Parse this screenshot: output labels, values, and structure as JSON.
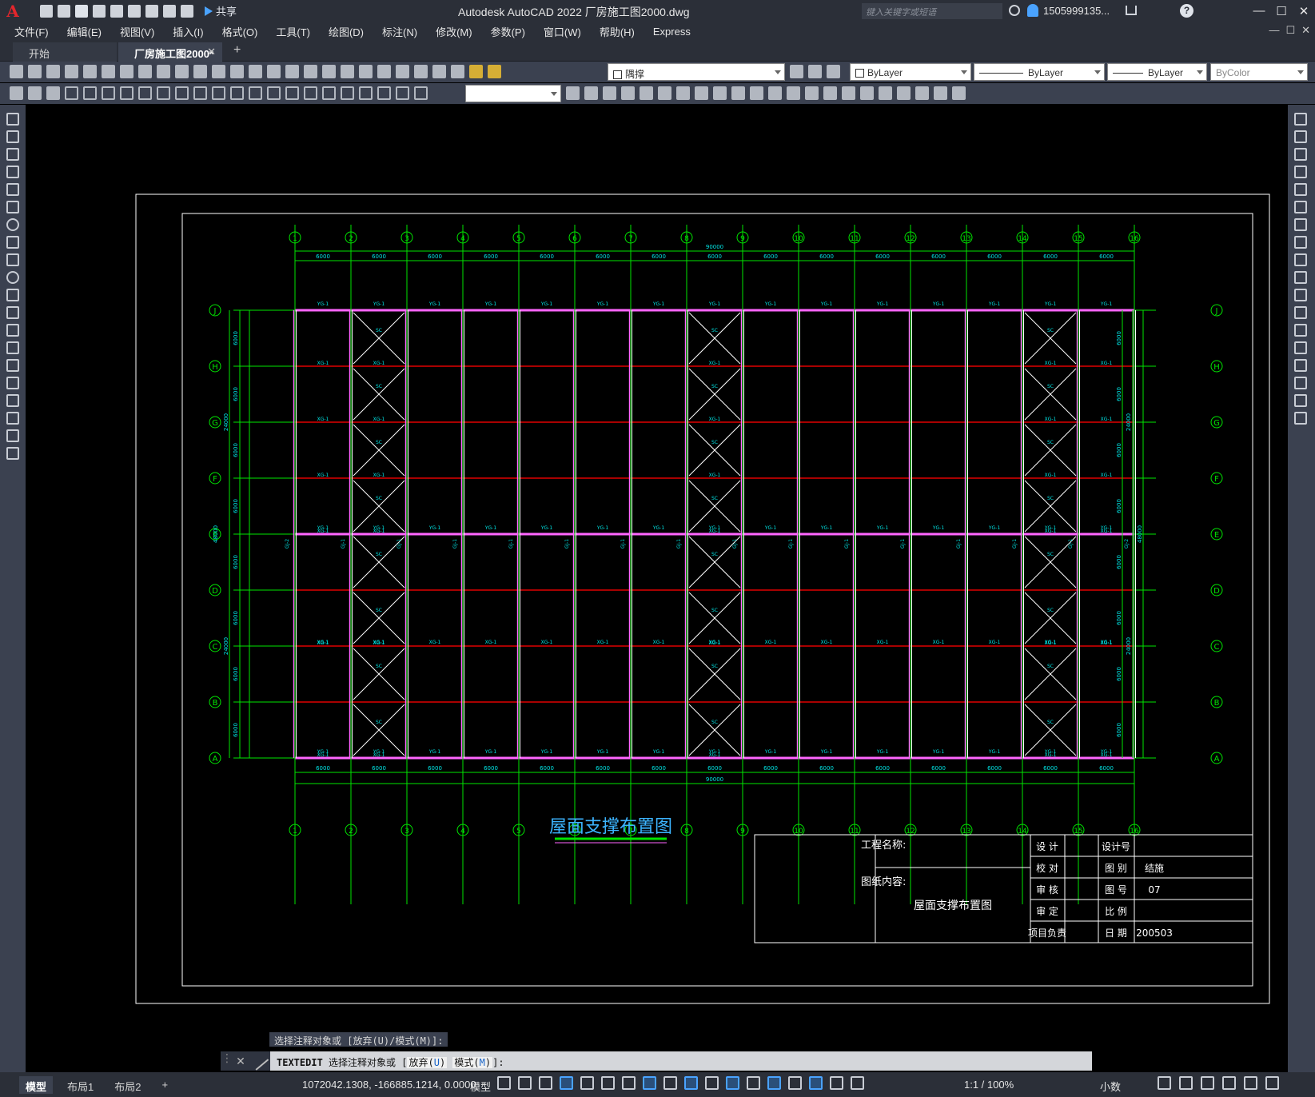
{
  "app": {
    "logo": "A",
    "title": "Autodesk AutoCAD 2022    厂房施工图2000.dwg",
    "share_label": "共享",
    "search_placeholder": "键入关键字或短语",
    "user": "1505999135...",
    "help": "?"
  },
  "window_controls": {
    "minimize": "—",
    "maximize": "☐",
    "close": "✕"
  },
  "menu": [
    "文件(F)",
    "编辑(E)",
    "视图(V)",
    "插入(I)",
    "格式(O)",
    "工具(T)",
    "绘图(D)",
    "标注(N)",
    "修改(M)",
    "参数(P)",
    "窗口(W)",
    "帮助(H)",
    "Express"
  ],
  "tabs": {
    "start": "开始",
    "active": "厂房施工图2000*",
    "close": "✕",
    "add": "+"
  },
  "properties": {
    "layer": "隅撑",
    "color": "ByLayer",
    "linetype": "ByLayer",
    "lineweight": "ByLayer",
    "plotstyle": "ByColor"
  },
  "drawing": {
    "column_axes": [
      "1",
      "2",
      "3",
      "4",
      "5",
      "6",
      "7",
      "8",
      "9",
      "10",
      "11",
      "12",
      "13",
      "14",
      "15",
      "16"
    ],
    "row_axes": [
      "J",
      "H",
      "G",
      "F",
      "E",
      "D",
      "C",
      "B",
      "A"
    ],
    "bay_dimension": "6000",
    "total_length": "90000",
    "row_dimension": "6000",
    "half_width": "24000",
    "total_width": "48000",
    "labels": {
      "purlin_edge": "YG-1",
      "tie": "XG-1",
      "brace": "SC",
      "gable_column": "GJ-1",
      "gable_column_end": "GJ-2"
    },
    "drawing_title": "屋面支撑布置图",
    "title_block": {
      "project_name_label": "工程名称:",
      "content_label": "图纸内容:",
      "content_value": "屋面支撑布置图",
      "design": "设  计",
      "check": "校  对",
      "review": "审  核",
      "approve": "审  定",
      "project_lead": "项目负责",
      "design_no_label": "设计号",
      "category_label": "图  别",
      "category_value": "结施",
      "sheet_no_label": "图  号",
      "sheet_no_value": "07",
      "scale_label": "比  例",
      "date_label": "日  期",
      "date_value": "200503"
    }
  },
  "command": {
    "history": "选择注释对象或 [放弃(U)/模式(M)]:",
    "cmd": "TEXTEDIT",
    "prompt": "选择注释对象或 [",
    "opt1_hot": "放弃(",
    "opt1_key": "U",
    "opt1_end": ")",
    "opt2_hot": "模式(",
    "opt2_key": "M",
    "opt2_end": ")",
    "tail": "]:"
  },
  "status": {
    "layouts": [
      "模型",
      "布局1",
      "布局2"
    ],
    "add_layout": "+",
    "coords": "1072042.1308, -166885.1214, 0.0000",
    "model": "模型",
    "scale": "1:1 / 100%",
    "units": "小数"
  }
}
